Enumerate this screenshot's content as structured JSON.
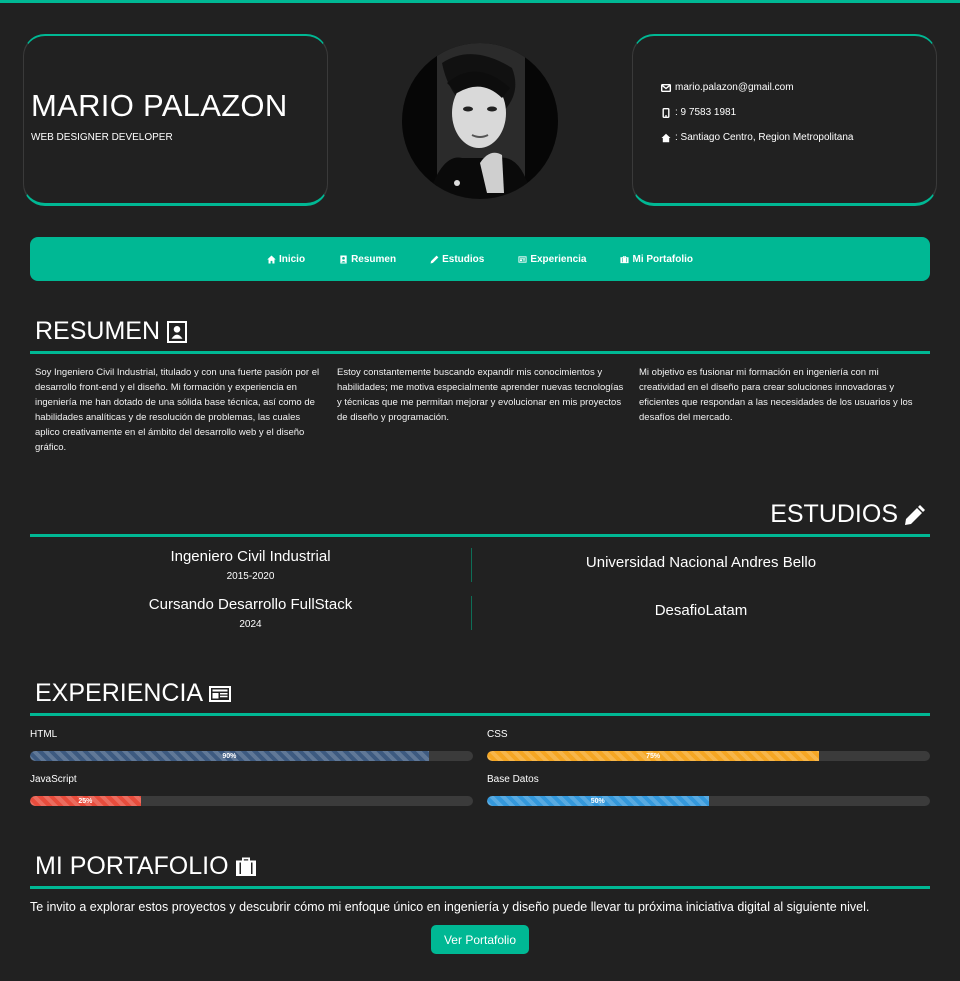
{
  "header": {
    "name": "MARIO PALAZON",
    "role": "WEB DESIGNER DEVELOPER",
    "email": "mario.palazon@gmail.com",
    "phone": ": 9 7583 1981",
    "address": ": Santiago Centro, Region Metropolitana"
  },
  "nav": {
    "items": [
      {
        "label": "Inicio",
        "icon": "home-icon"
      },
      {
        "label": "Resumen",
        "icon": "person-icon"
      },
      {
        "label": "Estudios",
        "icon": "pencil-icon"
      },
      {
        "label": "Experiencia",
        "icon": "newspaper-icon"
      },
      {
        "label": "Mi Portafolio",
        "icon": "briefcase-icon"
      }
    ]
  },
  "resumen": {
    "title": "RESUMEN",
    "paragraphs": [
      "Soy Ingeniero Civil Industrial, titulado y con una fuerte pasión por el desarrollo front-end y el diseño. Mi formación y experiencia en ingeniería me han dotado de una sólida base técnica, así como de habilidades analíticas y de resolución de problemas, las cuales aplico creativamente en el ámbito del desarrollo web y el diseño gráfico.",
      "Estoy constantemente buscando expandir mis conocimientos y habilidades; me motiva especialmente aprender nuevas tecnologías y técnicas que me permitan mejorar y evolucionar en mis proyectos de diseño y programación.",
      "Mi objetivo es fusionar mi formación en ingeniería con mi creatividad en el diseño para crear soluciones innovadoras y eficientes que respondan a las necesidades de los usuarios y los desafíos del mercado."
    ]
  },
  "estudios": {
    "title": "ESTUDIOS",
    "items": [
      {
        "degree": "Ingeniero Civil Industrial",
        "years": "2015-2020",
        "institution": "Universidad Nacional Andres Bello"
      },
      {
        "degree": "Cursando Desarrollo FullStack",
        "years": "2024",
        "institution": "DesafioLatam"
      }
    ]
  },
  "experiencia": {
    "title": "EXPERIENCIA",
    "skills": [
      {
        "name": "HTML",
        "percent": 90,
        "label": "90%",
        "color": "#3d5a80"
      },
      {
        "name": "CSS",
        "percent": 75,
        "label": "75%",
        "color": "#f5a623"
      },
      {
        "name": "JavaScript",
        "percent": 25,
        "label": "25%",
        "color": "#e74c3c"
      },
      {
        "name": "Base Datos",
        "percent": 50,
        "label": "50%",
        "color": "#3498db"
      }
    ]
  },
  "portafolio": {
    "title": "MI PORTAFOLIO",
    "text": "Te invito a explorar estos proyectos y descubrir cómo mi enfoque único en ingeniería y diseño puede llevar tu próxima iniciativa digital al siguiente nivel.",
    "button": "Ver Portafolio"
  },
  "colors": {
    "accent": "#00b894",
    "background": "#212121"
  }
}
